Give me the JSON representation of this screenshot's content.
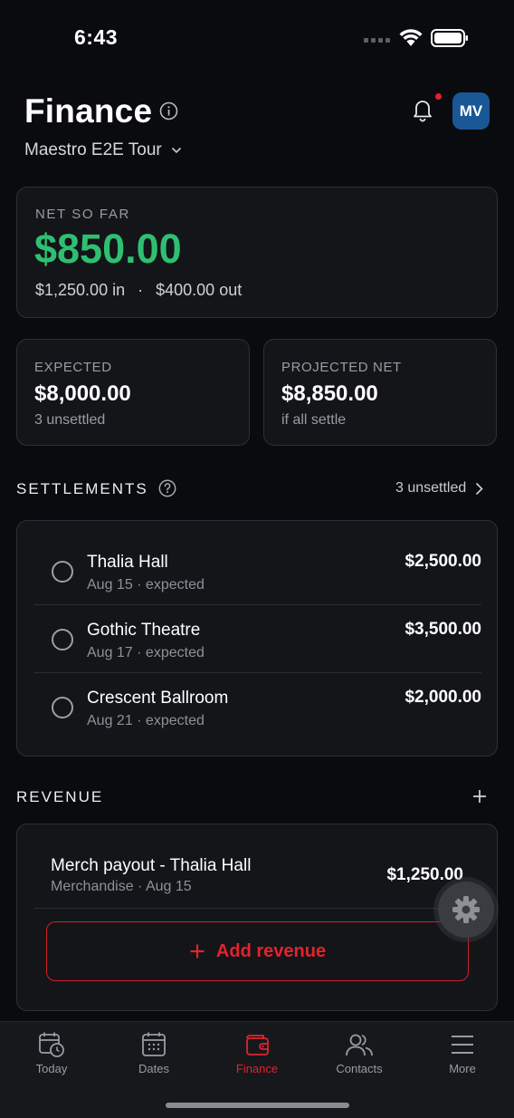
{
  "status_bar": {
    "time": "6:43"
  },
  "header": {
    "title": "Finance",
    "tour_name": "Maestro E2E Tour",
    "avatar_initials": "MV"
  },
  "net": {
    "label": "NET SO FAR",
    "value": "$850.00",
    "in": "$1,250.00 in",
    "separator": "·",
    "out": "$400.00 out"
  },
  "stats": {
    "expected": {
      "label": "EXPECTED",
      "value": "$8,000.00",
      "sub": "3 unsettled"
    },
    "projected": {
      "label": "PROJECTED NET",
      "value": "$8,850.00",
      "sub": "if all settle"
    }
  },
  "settlements": {
    "title": "SETTLEMENTS",
    "link": "3 unsettled",
    "rows": [
      {
        "name": "Thalia Hall",
        "sub": "Aug 15 · expected",
        "amount": "$2,500.00"
      },
      {
        "name": "Gothic Theatre",
        "sub": "Aug 17 · expected",
        "amount": "$3,500.00"
      },
      {
        "name": "Crescent Ballroom",
        "sub": "Aug 21 · expected",
        "amount": "$2,000.00"
      }
    ]
  },
  "revenue": {
    "title": "REVENUE",
    "item": {
      "name": "Merch payout - Thalia Hall",
      "sub": "Merchandise · Aug 15",
      "amount": "$1,250.00"
    },
    "add_label": "Add revenue"
  },
  "tabs": [
    {
      "label": "Today"
    },
    {
      "label": "Dates"
    },
    {
      "label": "Finance",
      "active": true
    },
    {
      "label": "Contacts"
    },
    {
      "label": "More"
    }
  ],
  "colors": {
    "positive": "#2fbf71",
    "accent": "#e0242d",
    "avatar": "#1a5796"
  }
}
